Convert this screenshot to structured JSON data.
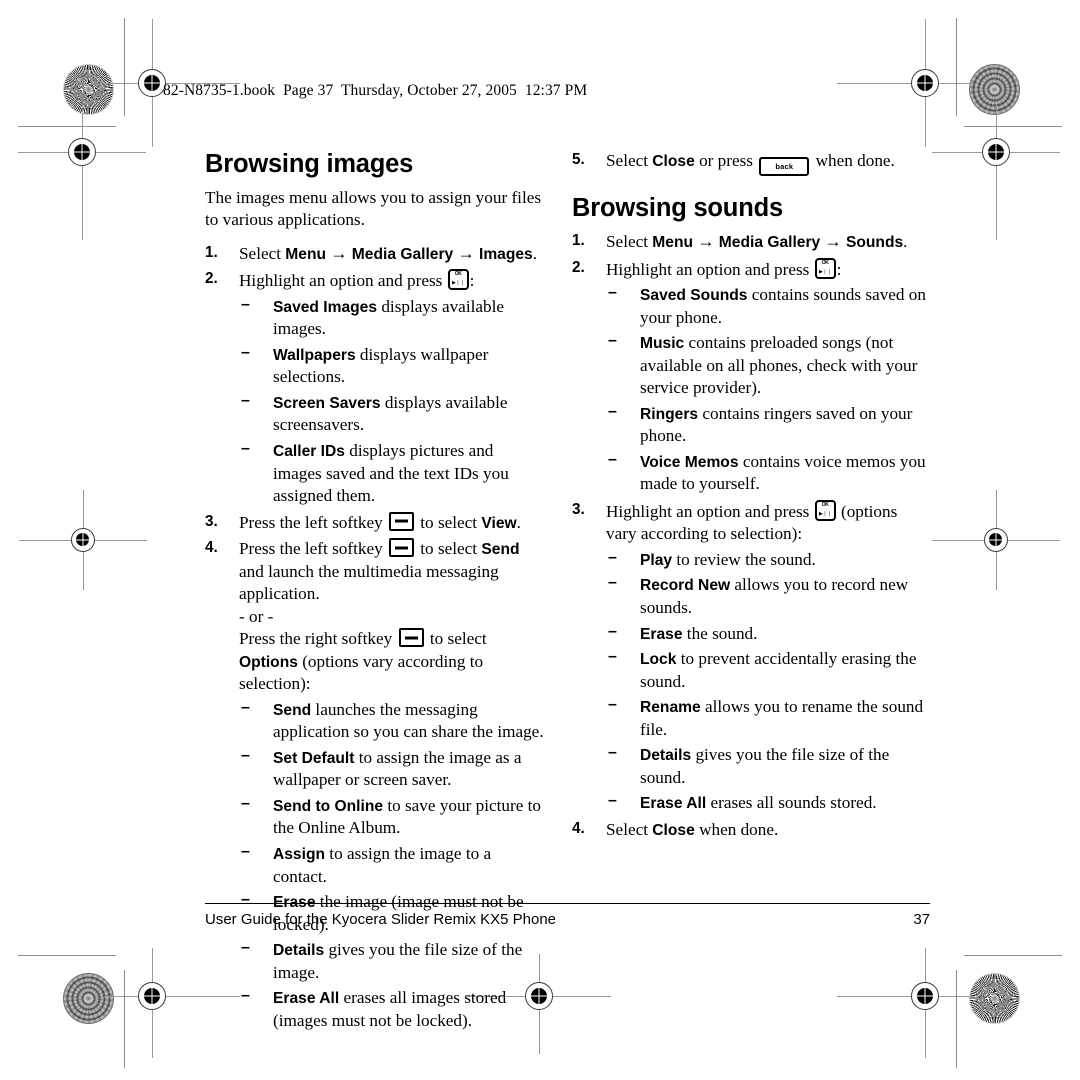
{
  "page": {
    "header_line": "82-N8735-1.book  Page 37  Thursday, October 27, 2005  12:37 PM",
    "footer_text": "User Guide for the Kyocera Slider Remix KX5 Phone",
    "page_number": "37"
  },
  "keys": {
    "ok_top": "OK",
    "ok_bottom": "▶❘❘",
    "back_label": "back",
    "softkey_name": "softkey-dash"
  },
  "left_column": {
    "heading": "Browsing images",
    "intro": "The images menu allows you to assign your files to various applications.",
    "steps": [
      {
        "num": "1.",
        "lead": "Select ",
        "bold1": "Menu",
        "arrow1": " → ",
        "bold2": "Media Gallery",
        "arrow2": " → ",
        "bold3": "Images",
        "tail": "."
      },
      {
        "num": "2.",
        "lead": "Highlight an option and press ",
        "tail": ":",
        "bullets": [
          {
            "dash": "–",
            "term": "Saved Images",
            "text": " displays available images."
          },
          {
            "dash": "–",
            "term": "Wallpapers",
            "text": " displays wallpaper selections."
          },
          {
            "dash": "–",
            "term": "Screen Savers",
            "text": " displays available screensavers."
          },
          {
            "dash": "–",
            "term": "Caller IDs",
            "text": " displays pictures and images saved and the text IDs you assigned them."
          }
        ]
      },
      {
        "num": "3.",
        "lead": "Press the left softkey ",
        "mid": " to select ",
        "bold1": "View",
        "tail": "."
      },
      {
        "num": "4.",
        "lead": "Press the left softkey ",
        "mid": " to select ",
        "bold1": "Send",
        "tail": " and launch the multimedia messaging application.",
        "or_text": "- or -",
        "lead2": "Press the right softkey ",
        "mid2": " to select ",
        "bold2": "Options",
        "tail2": " (options vary according to selection):",
        "bullets": [
          {
            "dash": "–",
            "term": "Send",
            "text": " launches the messaging application so you can share the image."
          },
          {
            "dash": "–",
            "term": "Set Default",
            "text": " to assign the image as a wallpaper or screen saver."
          },
          {
            "dash": "–",
            "term": "Send to Online",
            "text": " to save your picture to the Online Album."
          },
          {
            "dash": "–",
            "term": "Assign",
            "text": " to assign the image to a contact."
          },
          {
            "dash": "–",
            "term": "Erase",
            "text": " the image (image must not be locked)."
          },
          {
            "dash": "–",
            "term": "Details",
            "text": " gives you the file size of the image."
          },
          {
            "dash": "–",
            "term": "Erase All",
            "text": " erases all images stored (images must not be locked)."
          }
        ]
      }
    ]
  },
  "right_column": {
    "step5": {
      "num": "5.",
      "lead": "Select ",
      "bold1": "Close",
      "mid": " or press ",
      "tail": " when done."
    },
    "heading": "Browsing sounds",
    "steps": [
      {
        "num": "1.",
        "lead": "Select ",
        "bold1": "Menu",
        "arrow1": " → ",
        "bold2": "Media Gallery",
        "arrow2": " → ",
        "bold3": "Sounds",
        "tail": "."
      },
      {
        "num": "2.",
        "lead": "Highlight an option and press ",
        "tail": ":",
        "bullets": [
          {
            "dash": "–",
            "term": "Saved Sounds",
            "text": " contains sounds saved on your phone."
          },
          {
            "dash": "–",
            "term": "Music",
            "text": " contains preloaded songs (not available on all phones, check with your service provider)."
          },
          {
            "dash": "–",
            "term": "Ringers",
            "text": " contains ringers saved on your phone."
          },
          {
            "dash": "–",
            "term": "Voice Memos",
            "text": " contains voice memos you made to yourself."
          }
        ]
      },
      {
        "num": "3.",
        "lead": "Highlight an option and press ",
        "tail": " (options vary according to selection):",
        "bullets": [
          {
            "dash": "–",
            "term": "Play",
            "text": " to review the sound."
          },
          {
            "dash": "–",
            "term": "Record New",
            "text": " allows you to record new sounds."
          },
          {
            "dash": "–",
            "term": "Erase",
            "text": " the sound."
          },
          {
            "dash": "–",
            "term": "Lock",
            "text": " to prevent accidentally erasing the sound."
          },
          {
            "dash": "–",
            "term": "Rename",
            "text": " allows you to rename the sound file."
          },
          {
            "dash": "–",
            "term": "Details",
            "text": " gives you the file size of the sound."
          },
          {
            "dash": "–",
            "term": "Erase All",
            "text": " erases all sounds stored."
          }
        ]
      },
      {
        "num": "4.",
        "lead": "Select ",
        "bold1": "Close",
        "tail": " when done."
      }
    ]
  }
}
